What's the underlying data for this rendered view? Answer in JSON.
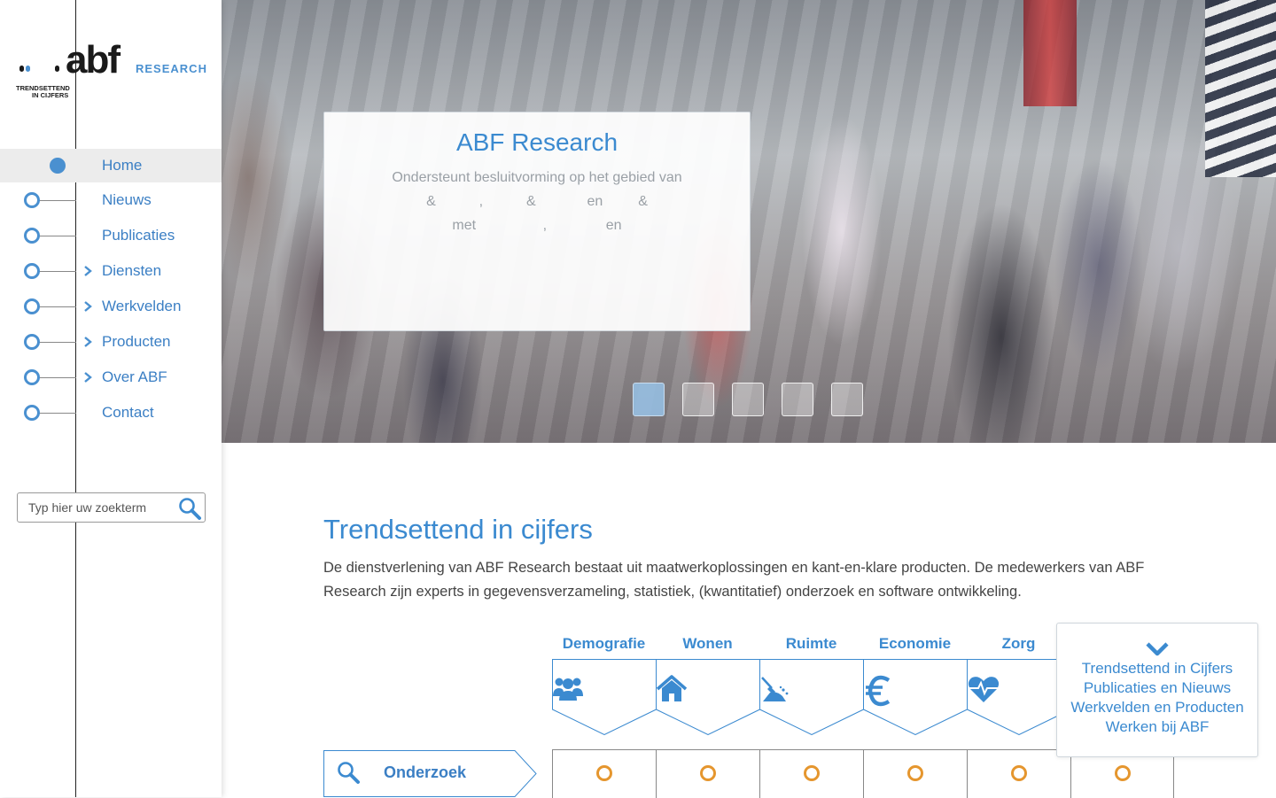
{
  "brand": {
    "logo_word": "abf",
    "logo_suffix": "RESEARCH",
    "tagline_line1": "TRENDSETTEND",
    "tagline_line2": "IN CIJFERS",
    "dot_colors": [
      "#1a1a1a",
      "#4a90d0",
      "#1a1a1a"
    ]
  },
  "sidebar": {
    "items": [
      {
        "label": "Home",
        "active": true,
        "has_children": false
      },
      {
        "label": "Nieuws",
        "active": false,
        "has_children": false
      },
      {
        "label": "Publicaties",
        "active": false,
        "has_children": false
      },
      {
        "label": "Diensten",
        "active": false,
        "has_children": true
      },
      {
        "label": "Werkvelden",
        "active": false,
        "has_children": true
      },
      {
        "label": "Producten",
        "active": false,
        "has_children": true
      },
      {
        "label": "Over ABF",
        "active": false,
        "has_children": true
      },
      {
        "label": "Contact",
        "active": false,
        "has_children": false
      }
    ]
  },
  "search": {
    "placeholder": "Typ hier uw zoekterm",
    "value": "",
    "icon": "magnifier-icon"
  },
  "hero": {
    "title": "ABF Research",
    "line1": "Ondersteunt besluitvorming op het gebied van",
    "line2": "&           ,           &             en         &",
    "line3": "met                 ,               en",
    "slide_count": 5,
    "active_slide": 1
  },
  "main": {
    "title": "Trendsettend in cijfers",
    "intro": "De dienstverlening van ABF Research bestaat uit maatwerkoplossingen en kant-en-klare producten. De medewerkers van ABF Research zijn experts in gegevensverzameling, statistiek, (kwantitatief) onderzoek en software ontwikkeling."
  },
  "categories": [
    {
      "label": "Demografie",
      "icon": "people-icon"
    },
    {
      "label": "Wonen",
      "icon": "house-icon"
    },
    {
      "label": "Ruimte",
      "icon": "shovel-icon"
    },
    {
      "label": "Economie",
      "icon": "euro-icon"
    },
    {
      "label": "Zorg",
      "icon": "heartbeat-icon"
    }
  ],
  "matrix": {
    "row_label": "Onderzoek",
    "row_icon": "magnifier-icon",
    "cells": 6
  },
  "quicknav": {
    "links": [
      "Trendsettend in Cijfers",
      "Publicaties en Nieuws",
      "Werkvelden en Producten",
      "Werken bij ABF"
    ]
  },
  "colors": {
    "accent": "#3b8ad0",
    "ring": "#e5962e"
  }
}
